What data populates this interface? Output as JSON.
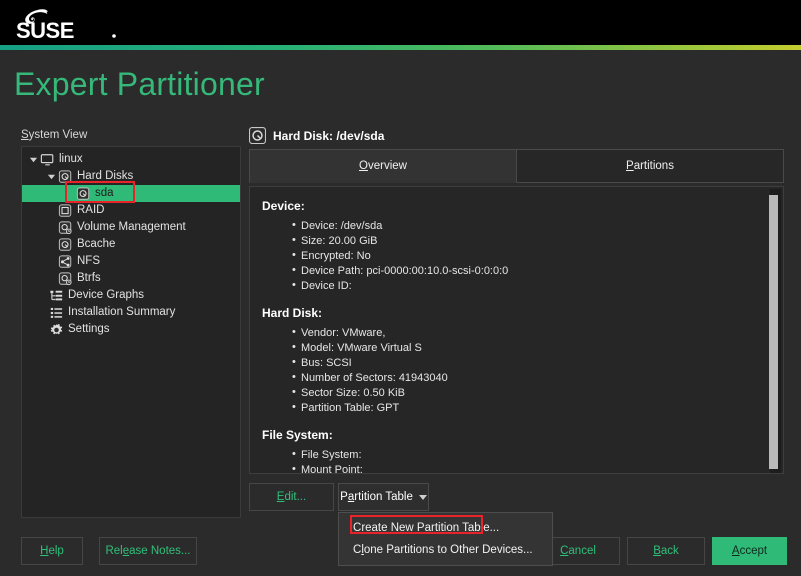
{
  "brand": {
    "logo_text": "SUSE",
    "accent": "#30ba78",
    "gradient_from": "#16a085",
    "gradient_to": "#c3cc2e"
  },
  "page": {
    "title": "Expert Partitioner"
  },
  "sidebar": {
    "label": "System View",
    "items": [
      {
        "label": "linux",
        "icon": "monitor-icon",
        "depth": 0,
        "twisty": "down",
        "selected": false
      },
      {
        "label": "Hard Disks",
        "icon": "hard-disk-icon",
        "depth": 1,
        "twisty": "down",
        "selected": false
      },
      {
        "label": "sda",
        "icon": "hard-disk-icon",
        "depth": 2,
        "twisty": "none",
        "selected": true
      },
      {
        "label": "RAID",
        "icon": "raid-icon",
        "depth": 1,
        "twisty": "none",
        "selected": false
      },
      {
        "label": "Volume Management",
        "icon": "volume-management-icon",
        "depth": 1,
        "twisty": "none",
        "selected": false
      },
      {
        "label": "Bcache",
        "icon": "bcache-icon",
        "depth": 1,
        "twisty": "none",
        "selected": false
      },
      {
        "label": "NFS",
        "icon": "nfs-share-icon",
        "depth": 1,
        "twisty": "none",
        "selected": false
      },
      {
        "label": "Btrfs",
        "icon": "btrfs-icon",
        "depth": 1,
        "twisty": "none",
        "selected": false
      },
      {
        "label": "Device Graphs",
        "icon": "device-graph-icon",
        "depth": 0.5,
        "twisty": "none",
        "selected": false
      },
      {
        "label": "Installation Summary",
        "icon": "list-icon",
        "depth": 0.5,
        "twisty": "none",
        "selected": false
      },
      {
        "label": "Settings",
        "icon": "gear-icon",
        "depth": 0.5,
        "twisty": "none",
        "selected": false
      }
    ]
  },
  "main": {
    "header_title": "Hard Disk: /dev/sda",
    "header_icon": "hard-disk-icon",
    "tabs": [
      {
        "label": "Overview",
        "mnemonic": "O",
        "active": true
      },
      {
        "label": "Partitions",
        "mnemonic": "P",
        "active": false
      }
    ],
    "sections": [
      {
        "title": "Device:",
        "items": [
          "Device: /dev/sda",
          "Size: 20.00 GiB",
          "Encrypted: No",
          "Device Path: pci-0000:00:10.0-scsi-0:0:0:0",
          "Device ID:"
        ]
      },
      {
        "title": "Hard Disk:",
        "items": [
          "Vendor: VMware,",
          "Model: VMware Virtual S",
          "Bus: SCSI",
          "Number of Sectors: 41943040",
          "Sector Size: 0.50 KiB",
          "Partition Table: GPT"
        ]
      },
      {
        "title": "File System:",
        "items": [
          "File System:",
          "Mount Point:"
        ]
      }
    ]
  },
  "actions": {
    "edit_label": "Edit...",
    "partition_table_label": "Partition Table",
    "partition_table_menu": [
      {
        "label": "Create New Partition Table...",
        "mnemonic": "C",
        "highlighted": true
      },
      {
        "label": "Clone Partitions to Other Devices...",
        "mnemonic": "l",
        "highlighted": false
      }
    ]
  },
  "footer": {
    "help_label": "Help",
    "release_notes_label": "Release Notes...",
    "cancel_label": "Cancel",
    "back_label": "Back",
    "accept_label": "Accept"
  },
  "annotations": [
    {
      "name": "sda-tree-item-highlight",
      "color": "#e8232a"
    },
    {
      "name": "create-new-partition-table-highlight",
      "color": "#e8232a"
    }
  ]
}
